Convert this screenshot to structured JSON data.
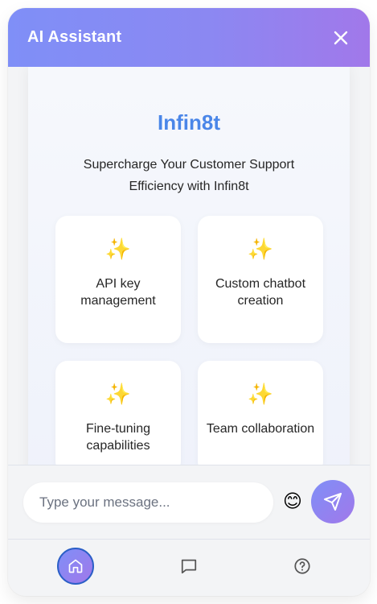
{
  "header": {
    "title": "AI Assistant",
    "close_icon": "close-icon"
  },
  "welcome": {
    "brand": "Infin8t",
    "tagline": "Supercharge Your Customer Support Efficiency with Infin8t",
    "features": [
      {
        "icon": "sparkles-icon",
        "label": "API key management"
      },
      {
        "icon": "sparkles-icon",
        "label": "Custom chatbot creation"
      },
      {
        "icon": "sparkles-icon",
        "label": "Fine-tuning capabilities"
      },
      {
        "icon": "sparkles-icon",
        "label": "Team collaboration"
      }
    ]
  },
  "composer": {
    "placeholder": "Type your message...",
    "value": "",
    "emoji_icon": "smiley-emoji-icon",
    "send_icon": "send-icon"
  },
  "bottom_nav": {
    "items": [
      {
        "name": "home",
        "icon": "home-icon",
        "active": true
      },
      {
        "name": "chat",
        "icon": "chat-icon",
        "active": false
      },
      {
        "name": "help",
        "icon": "help-icon",
        "active": false
      }
    ]
  },
  "colors": {
    "header_gradient_start": "#7f8ff7",
    "header_gradient_end": "#a178ea",
    "brand": "#4a86e8",
    "active_nav_border": "#2b5fc7"
  }
}
